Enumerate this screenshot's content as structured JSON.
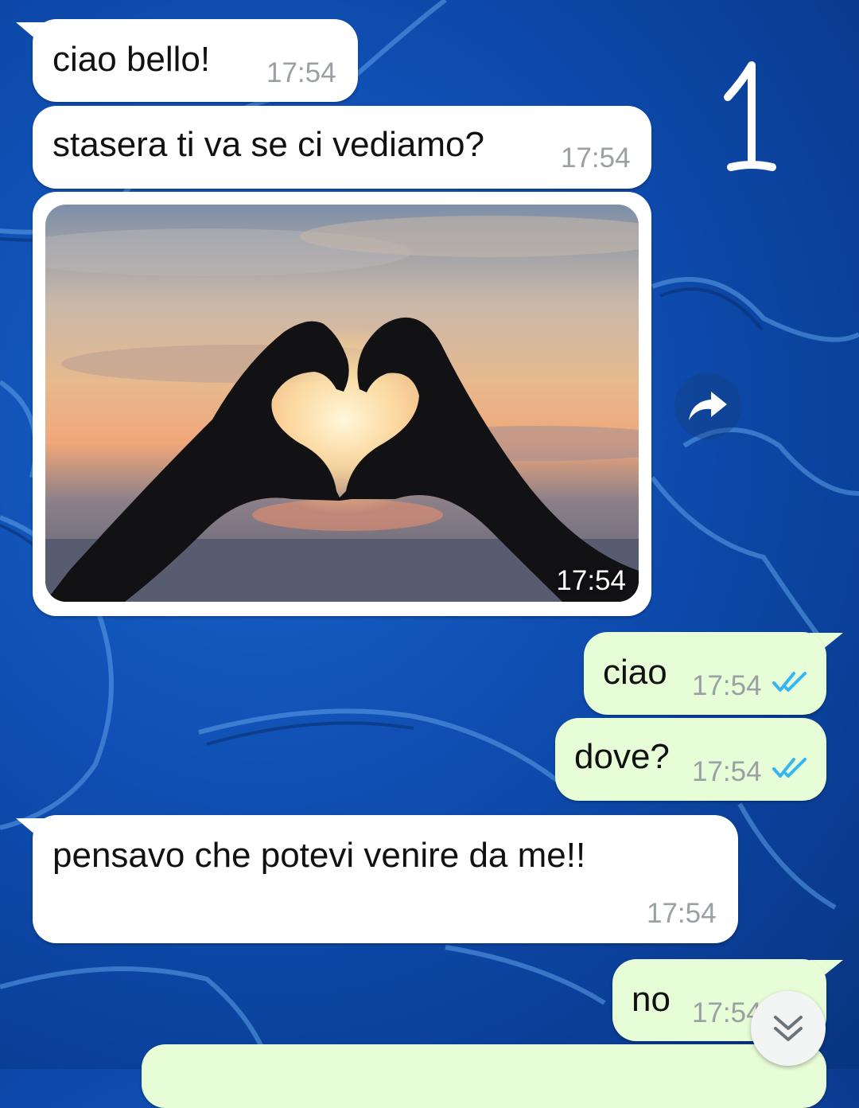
{
  "messages": [
    {
      "dir": "in",
      "text": "ciao bello!",
      "time": "17:54"
    },
    {
      "dir": "in",
      "text": "stasera ti va se ci vediamo?",
      "time": "17:54"
    },
    {
      "dir": "in",
      "type": "image",
      "image_subject": "heart-hands-sunset-photo",
      "time": "17:54"
    },
    {
      "dir": "out",
      "text": "ciao",
      "time": "17:54",
      "status": "read"
    },
    {
      "dir": "out",
      "text": "dove?",
      "time": "17:54",
      "status": "read"
    },
    {
      "dir": "in",
      "text": "pensavo che potevi venire da me!!",
      "time": "17:54"
    },
    {
      "dir": "out",
      "text": "no",
      "time": "17:54",
      "status": "read"
    }
  ],
  "annotation": {
    "text": "1"
  },
  "icons": {
    "forward": "forward-arrow-icon",
    "scroll_down": "chevron-double-down-icon",
    "read_ticks": "double-check-icon"
  },
  "colors": {
    "incoming_bubble": "#ffffff",
    "outgoing_bubble": "#e7fdd7",
    "read_tick": "#34b7f1",
    "timestamp": "#9aa0a3",
    "wallpaper": "#0f4fb3"
  }
}
